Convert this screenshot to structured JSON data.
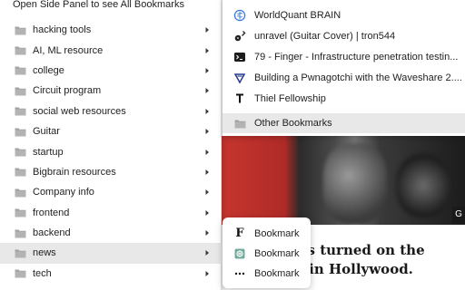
{
  "background": {
    "headline_line1": "tars turned on the",
    "headline_line2": "ds in Hollywood.",
    "corner_glyph": "G"
  },
  "menu": {
    "side_panel_label": "Open Side Panel to see All Bookmarks",
    "folders": [
      {
        "label": "hacking tools"
      },
      {
        "label": "AI, ML resource"
      },
      {
        "label": "college"
      },
      {
        "label": "Circuit program"
      },
      {
        "label": "social web resources"
      },
      {
        "label": "Guitar"
      },
      {
        "label": "startup"
      },
      {
        "label": "Bigbrain resources"
      },
      {
        "label": "Company info"
      },
      {
        "label": "frontend"
      },
      {
        "label": "backend"
      },
      {
        "label": "news",
        "hovered": true
      },
      {
        "label": "tech"
      }
    ]
  },
  "submenu": {
    "items": [
      {
        "label": "WorldQuant BRAIN",
        "icon": "brain-icon"
      },
      {
        "label": "unravel (Guitar Cover) | tron544",
        "icon": "guitar-icon"
      },
      {
        "label": "79 - Finger - Infrastructure penetration testin...",
        "icon": "terminal-icon"
      },
      {
        "label": "Building a Pwnagotchi with the Waveshare 2....",
        "icon": "pwnagotchi-icon"
      },
      {
        "label": "Thiel Fellowship",
        "icon": "t-icon"
      }
    ],
    "other_bookmarks_label": "Other Bookmarks"
  },
  "small_menu": {
    "items": [
      {
        "label": "Bookmark",
        "icon": "f-logo-icon"
      },
      {
        "label": "Bookmark",
        "icon": "openai-icon"
      },
      {
        "label": "Bookmark",
        "icon": "dots-icon"
      }
    ]
  },
  "colors": {
    "hover_background": "#e8e8e8",
    "menu_background": "#ffffff",
    "folder_icon": "#9a9a9a"
  }
}
